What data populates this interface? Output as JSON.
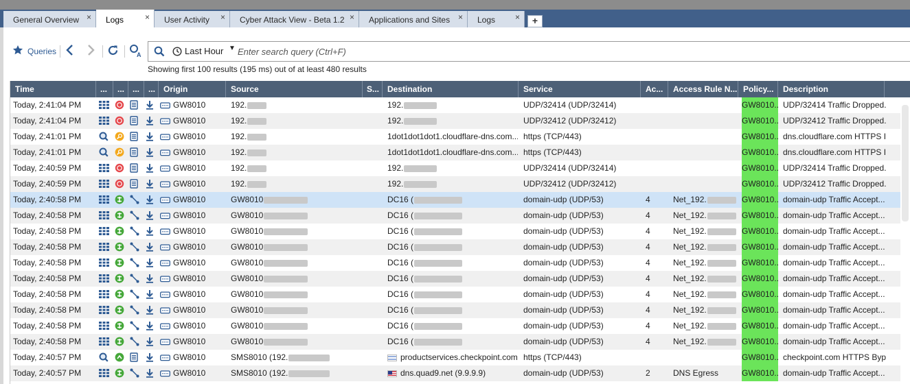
{
  "tabs": [
    {
      "label": "General Overview",
      "close": "×",
      "active": false
    },
    {
      "label": "Logs",
      "close": "×",
      "active": true
    },
    {
      "label": "User Activity",
      "close": "×",
      "active": false
    },
    {
      "label": "Cyber Attack View - Beta 1.2",
      "close": "×",
      "active": false
    },
    {
      "label": "Applications and Sites",
      "close": "×",
      "active": false
    },
    {
      "label": "Logs",
      "close": "×",
      "active": false
    }
  ],
  "new_tab_label": "+",
  "toolbar": {
    "queries_label": "Queries",
    "time_range": "Last Hour",
    "search_placeholder": "Enter search query (Ctrl+F)"
  },
  "results_info": "Showing first 100 results (195 ms) out of at least 480 results",
  "columns": [
    "Time",
    "...",
    "...",
    "...",
    "...",
    "Origin",
    "Source",
    "S...",
    "Destination",
    "Service",
    "Ac...",
    "Access Rule N...",
    "Policy...",
    "Description"
  ],
  "rows": [
    {
      "time": "Today, 2:41:04 PM",
      "type": "drop",
      "origin": "GW8010",
      "source": "192.",
      "destination": "192.",
      "service": "UDP/32414 (UDP/32414)",
      "action": "",
      "rule": "",
      "policy": "GW8010...",
      "description": "UDP/32414 Traffic Dropped..."
    },
    {
      "time": "Today, 2:41:04 PM",
      "type": "drop",
      "origin": "GW8010",
      "source": "192.",
      "destination": "192.",
      "service": "UDP/32412 (UDP/32412)",
      "action": "",
      "rule": "",
      "policy": "GW8010...",
      "description": "UDP/32412 Traffic Dropped..."
    },
    {
      "time": "Today, 2:41:01 PM",
      "type": "inspect",
      "origin": "GW8010",
      "source": "192.",
      "destination": "1dot1dot1dot1.cloudflare-dns.com...",
      "service": "https (TCP/443)",
      "action": "",
      "rule": "",
      "policy": "GW8010...",
      "description": "dns.cloudflare.com HTTPS I..."
    },
    {
      "time": "Today, 2:41:01 PM",
      "type": "inspect",
      "origin": "GW8010",
      "source": "192.",
      "destination": "1dot1dot1dot1.cloudflare-dns.com...",
      "service": "https (TCP/443)",
      "action": "",
      "rule": "",
      "policy": "GW8010...",
      "description": "dns.cloudflare.com HTTPS I..."
    },
    {
      "time": "Today, 2:40:59 PM",
      "type": "drop",
      "origin": "GW8010",
      "source": "192.",
      "destination": "192.",
      "service": "UDP/32414 (UDP/32414)",
      "action": "",
      "rule": "",
      "policy": "GW8010...",
      "description": "UDP/32414 Traffic Dropped..."
    },
    {
      "time": "Today, 2:40:59 PM",
      "type": "drop",
      "origin": "GW8010",
      "source": "192.",
      "destination": "192.",
      "service": "UDP/32412 (UDP/32412)",
      "action": "",
      "rule": "",
      "policy": "GW8010...",
      "description": "UDP/32412 Traffic Dropped..."
    },
    {
      "time": "Today, 2:40:58 PM",
      "type": "accept",
      "origin": "GW8010",
      "source": "GW8010",
      "destination": "DC16 (",
      "service": "domain-udp (UDP/53)",
      "action": "4",
      "rule": "Net_192.",
      "policy": "GW8010...",
      "description": "domain-udp Traffic Accept..."
    },
    {
      "time": "Today, 2:40:58 PM",
      "type": "accept",
      "origin": "GW8010",
      "source": "GW8010",
      "destination": "DC16 (",
      "service": "domain-udp (UDP/53)",
      "action": "4",
      "rule": "Net_192.",
      "policy": "GW8010...",
      "description": "domain-udp Traffic Accept..."
    },
    {
      "time": "Today, 2:40:58 PM",
      "type": "accept",
      "origin": "GW8010",
      "source": "GW8010",
      "destination": "DC16 (",
      "service": "domain-udp (UDP/53)",
      "action": "4",
      "rule": "Net_192.",
      "policy": "GW8010...",
      "description": "domain-udp Traffic Accept..."
    },
    {
      "time": "Today, 2:40:58 PM",
      "type": "accept",
      "origin": "GW8010",
      "source": "GW8010",
      "destination": "DC16 (",
      "service": "domain-udp (UDP/53)",
      "action": "4",
      "rule": "Net_192.",
      "policy": "GW8010...",
      "description": "domain-udp Traffic Accept..."
    },
    {
      "time": "Today, 2:40:58 PM",
      "type": "accept",
      "origin": "GW8010",
      "source": "GW8010",
      "destination": "DC16 (",
      "service": "domain-udp (UDP/53)",
      "action": "4",
      "rule": "Net_192.",
      "policy": "GW8010...",
      "description": "domain-udp Traffic Accept..."
    },
    {
      "time": "Today, 2:40:58 PM",
      "type": "accept",
      "origin": "GW8010",
      "source": "GW8010",
      "destination": "DC16 (",
      "service": "domain-udp (UDP/53)",
      "action": "4",
      "rule": "Net_192.",
      "policy": "GW8010...",
      "description": "domain-udp Traffic Accept..."
    },
    {
      "time": "Today, 2:40:58 PM",
      "type": "accept",
      "origin": "GW8010",
      "source": "GW8010",
      "destination": "DC16 (",
      "service": "domain-udp (UDP/53)",
      "action": "4",
      "rule": "Net_192.",
      "policy": "GW8010...",
      "description": "domain-udp Traffic Accept..."
    },
    {
      "time": "Today, 2:40:58 PM",
      "type": "accept",
      "origin": "GW8010",
      "source": "GW8010",
      "destination": "DC16 (",
      "service": "domain-udp (UDP/53)",
      "action": "4",
      "rule": "Net_192.",
      "policy": "GW8010...",
      "description": "domain-udp Traffic Accept..."
    },
    {
      "time": "Today, 2:40:58 PM",
      "type": "accept",
      "origin": "GW8010",
      "source": "GW8010",
      "destination": "DC16 (",
      "service": "domain-udp (UDP/53)",
      "action": "4",
      "rule": "Net_192.",
      "policy": "GW8010...",
      "description": "domain-udp Traffic Accept..."
    },
    {
      "time": "Today, 2:40:58 PM",
      "type": "accept",
      "origin": "GW8010",
      "source": "GW8010",
      "destination": "DC16 (",
      "service": "domain-udp (UDP/53)",
      "action": "4",
      "rule": "Net_192.",
      "policy": "GW8010...",
      "description": "domain-udp Traffic Accept..."
    },
    {
      "time": "Today, 2:40:57 PM",
      "type": "bypass",
      "origin": "GW8010",
      "source": "SMS8010 (192.",
      "destination": "productservices.checkpoint.com...",
      "flag": "il",
      "service": "https (TCP/443)",
      "action": "",
      "rule": "",
      "policy": "GW8010...",
      "description": "checkpoint.com HTTPS Byp..."
    },
    {
      "time": "Today, 2:40:57 PM",
      "type": "accept",
      "origin": "GW8010",
      "source": "SMS8010 (192.",
      "destination": "dns.quad9.net (9.9.9.9)",
      "flag": "us",
      "service": "domain-udp (UDP/53)",
      "action": "2",
      "rule": "DNS Egress",
      "policy": "GW8010...",
      "description": "domain-udp Traffic Accept..."
    }
  ],
  "selected_row": 6,
  "colors": {
    "tabbar": "#41608a",
    "header": "#4d6077",
    "policy_highlight": "#6be45a",
    "selected": "#cfe3f7",
    "accent": "#2d5a93"
  }
}
